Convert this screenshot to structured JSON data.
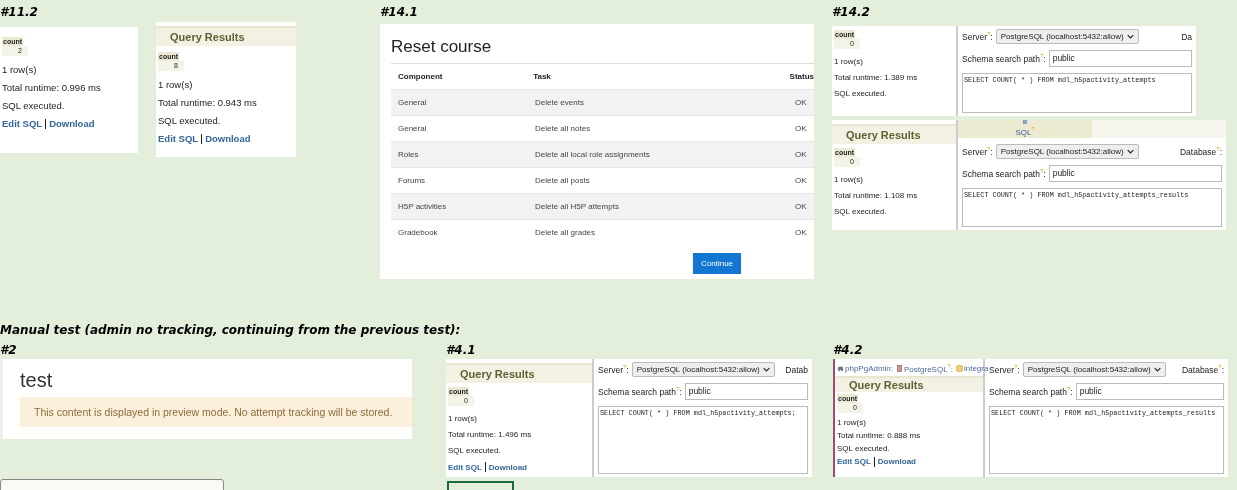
{
  "top_sections": [
    {
      "label": "#11.2",
      "shots": [
        {
          "kind": "results",
          "column": "count",
          "value": "2",
          "rows_text": "1 row(s)",
          "runtime": "Total runtime: 0.996 ms",
          "status": "SQL executed.",
          "links": [
            "Edit SQL",
            "Download"
          ]
        },
        {
          "kind": "results",
          "heading": "Query Results",
          "column": "count",
          "value": "8",
          "rows_text": "1 row(s)",
          "runtime": "Total runtime: 0.943 ms",
          "status": "SQL executed.",
          "links": [
            "Edit SQL",
            "Download"
          ]
        }
      ]
    },
    {
      "label": "#14.1",
      "shots": [
        {
          "kind": "reset_course",
          "title": "Reset course",
          "columns": [
            "Component",
            "Task",
            "Status"
          ],
          "rows": [
            [
              "General",
              "Delete events",
              "OK"
            ],
            [
              "General",
              "Delete all notes",
              "OK"
            ],
            [
              "Roles",
              "Delete all local role assignments",
              "OK"
            ],
            [
              "Forums",
              "Delete all posts",
              "OK"
            ],
            [
              "H5P activities",
              "Delete all H5P attempts",
              "OK"
            ],
            [
              "Gradebook",
              "Delete all grades",
              "OK"
            ]
          ],
          "button": "Continue"
        }
      ]
    },
    {
      "label": "#14.2",
      "shots": [
        {
          "kind": "results_sql",
          "column": "count",
          "value": "0",
          "rows_text": "1 row(s)",
          "runtime": "Total runtime: 1.389 ms",
          "status": "SQL executed.",
          "editor": {
            "server_label": "Server$^{?}$:",
            "server_value": "PostgreSQL (localhost:5432:allow)",
            "database_label": "Da",
            "schema_label": "Schema search path$^{?}$:",
            "schema_value": "public",
            "sql": "SELECT COUNT( * ) FROM mdl_h5pactivity_attempts"
          }
        },
        {
          "kind": "results_sql",
          "heading": "Query Results",
          "column": "count",
          "value": "0",
          "rows_text": "1 row(s)",
          "runtime": "Total runtime: 1.108 ms",
          "status": "SQL executed.",
          "editor": {
            "tabs": [
              {
                "label": "SQL$^{?}$",
                "selected": true
              }
            ],
            "server_label": "Server$^{?}$:",
            "server_value": "PostgreSQL (localhost:5432:allow)",
            "database_label": "Database$^{?}$:",
            "schema_label": "Schema search path$^{?}$:",
            "schema_value": "public",
            "sql": "SELECT COUNT( * ) FROM mdl_h5pactivity_attempts_results"
          }
        }
      ]
    }
  ],
  "manual_test": {
    "heading": "Manual test (admin no tracking, continuing from the previous test):",
    "sections": [
      {
        "label": "#2",
        "shots": [
          {
            "kind": "preview",
            "title": "test",
            "notice": "This content is displayed in preview mode. No attempt tracking will be stored."
          }
        ]
      },
      {
        "label": "#4.1",
        "shots": [
          {
            "kind": "results_sql",
            "heading": "Query Results",
            "column": "count",
            "value": "0",
            "rows_text": "1 row(s)",
            "runtime": "Total runtime: 1.496 ms",
            "status": "SQL executed.",
            "links": [
              "Edit SQL",
              "Download"
            ],
            "editor": {
              "server_label": "Server$^{?}$:",
              "server_value": "PostgreSQL (localhost:5432:allow)",
              "database_label": "Datab",
              "schema_label": "Schema search path$^{?}$:",
              "schema_value": "public",
              "sql": "SELECT COUNT( * ) FROM mdl_h5pactivity_attempts;"
            }
          }
        ]
      },
      {
        "label": "#4.2",
        "shots": [
          {
            "kind": "results_sql",
            "breadcrumb": [
              {
                "kind": "app",
                "label": "phpPgAdmin:"
              },
              {
                "kind": "server",
                "label": "PostgreSQL$^{?}$:"
              },
              {
                "kind": "database",
                "label": "integra"
              }
            ],
            "heading": "Query Results",
            "column": "count",
            "value": "0",
            "rows_text": "1 row(s)",
            "runtime": "Total runtime: 0.888 ms",
            "status": "SQL executed.",
            "links": [
              "Edit SQL",
              "Download"
            ],
            "editor": {
              "server_label": "Server$^{?}$:",
              "server_value": "PostgreSQL (localhost:5432:allow)",
              "database_label": "Database$^{?}$:",
              "schema_label": "Schema search path$^{?}$:",
              "schema_value": "public",
              "sql": "SELECT COUNT( * ) FROM mdl_h5pactivity_attempts_results"
            }
          }
        ]
      }
    ]
  }
}
